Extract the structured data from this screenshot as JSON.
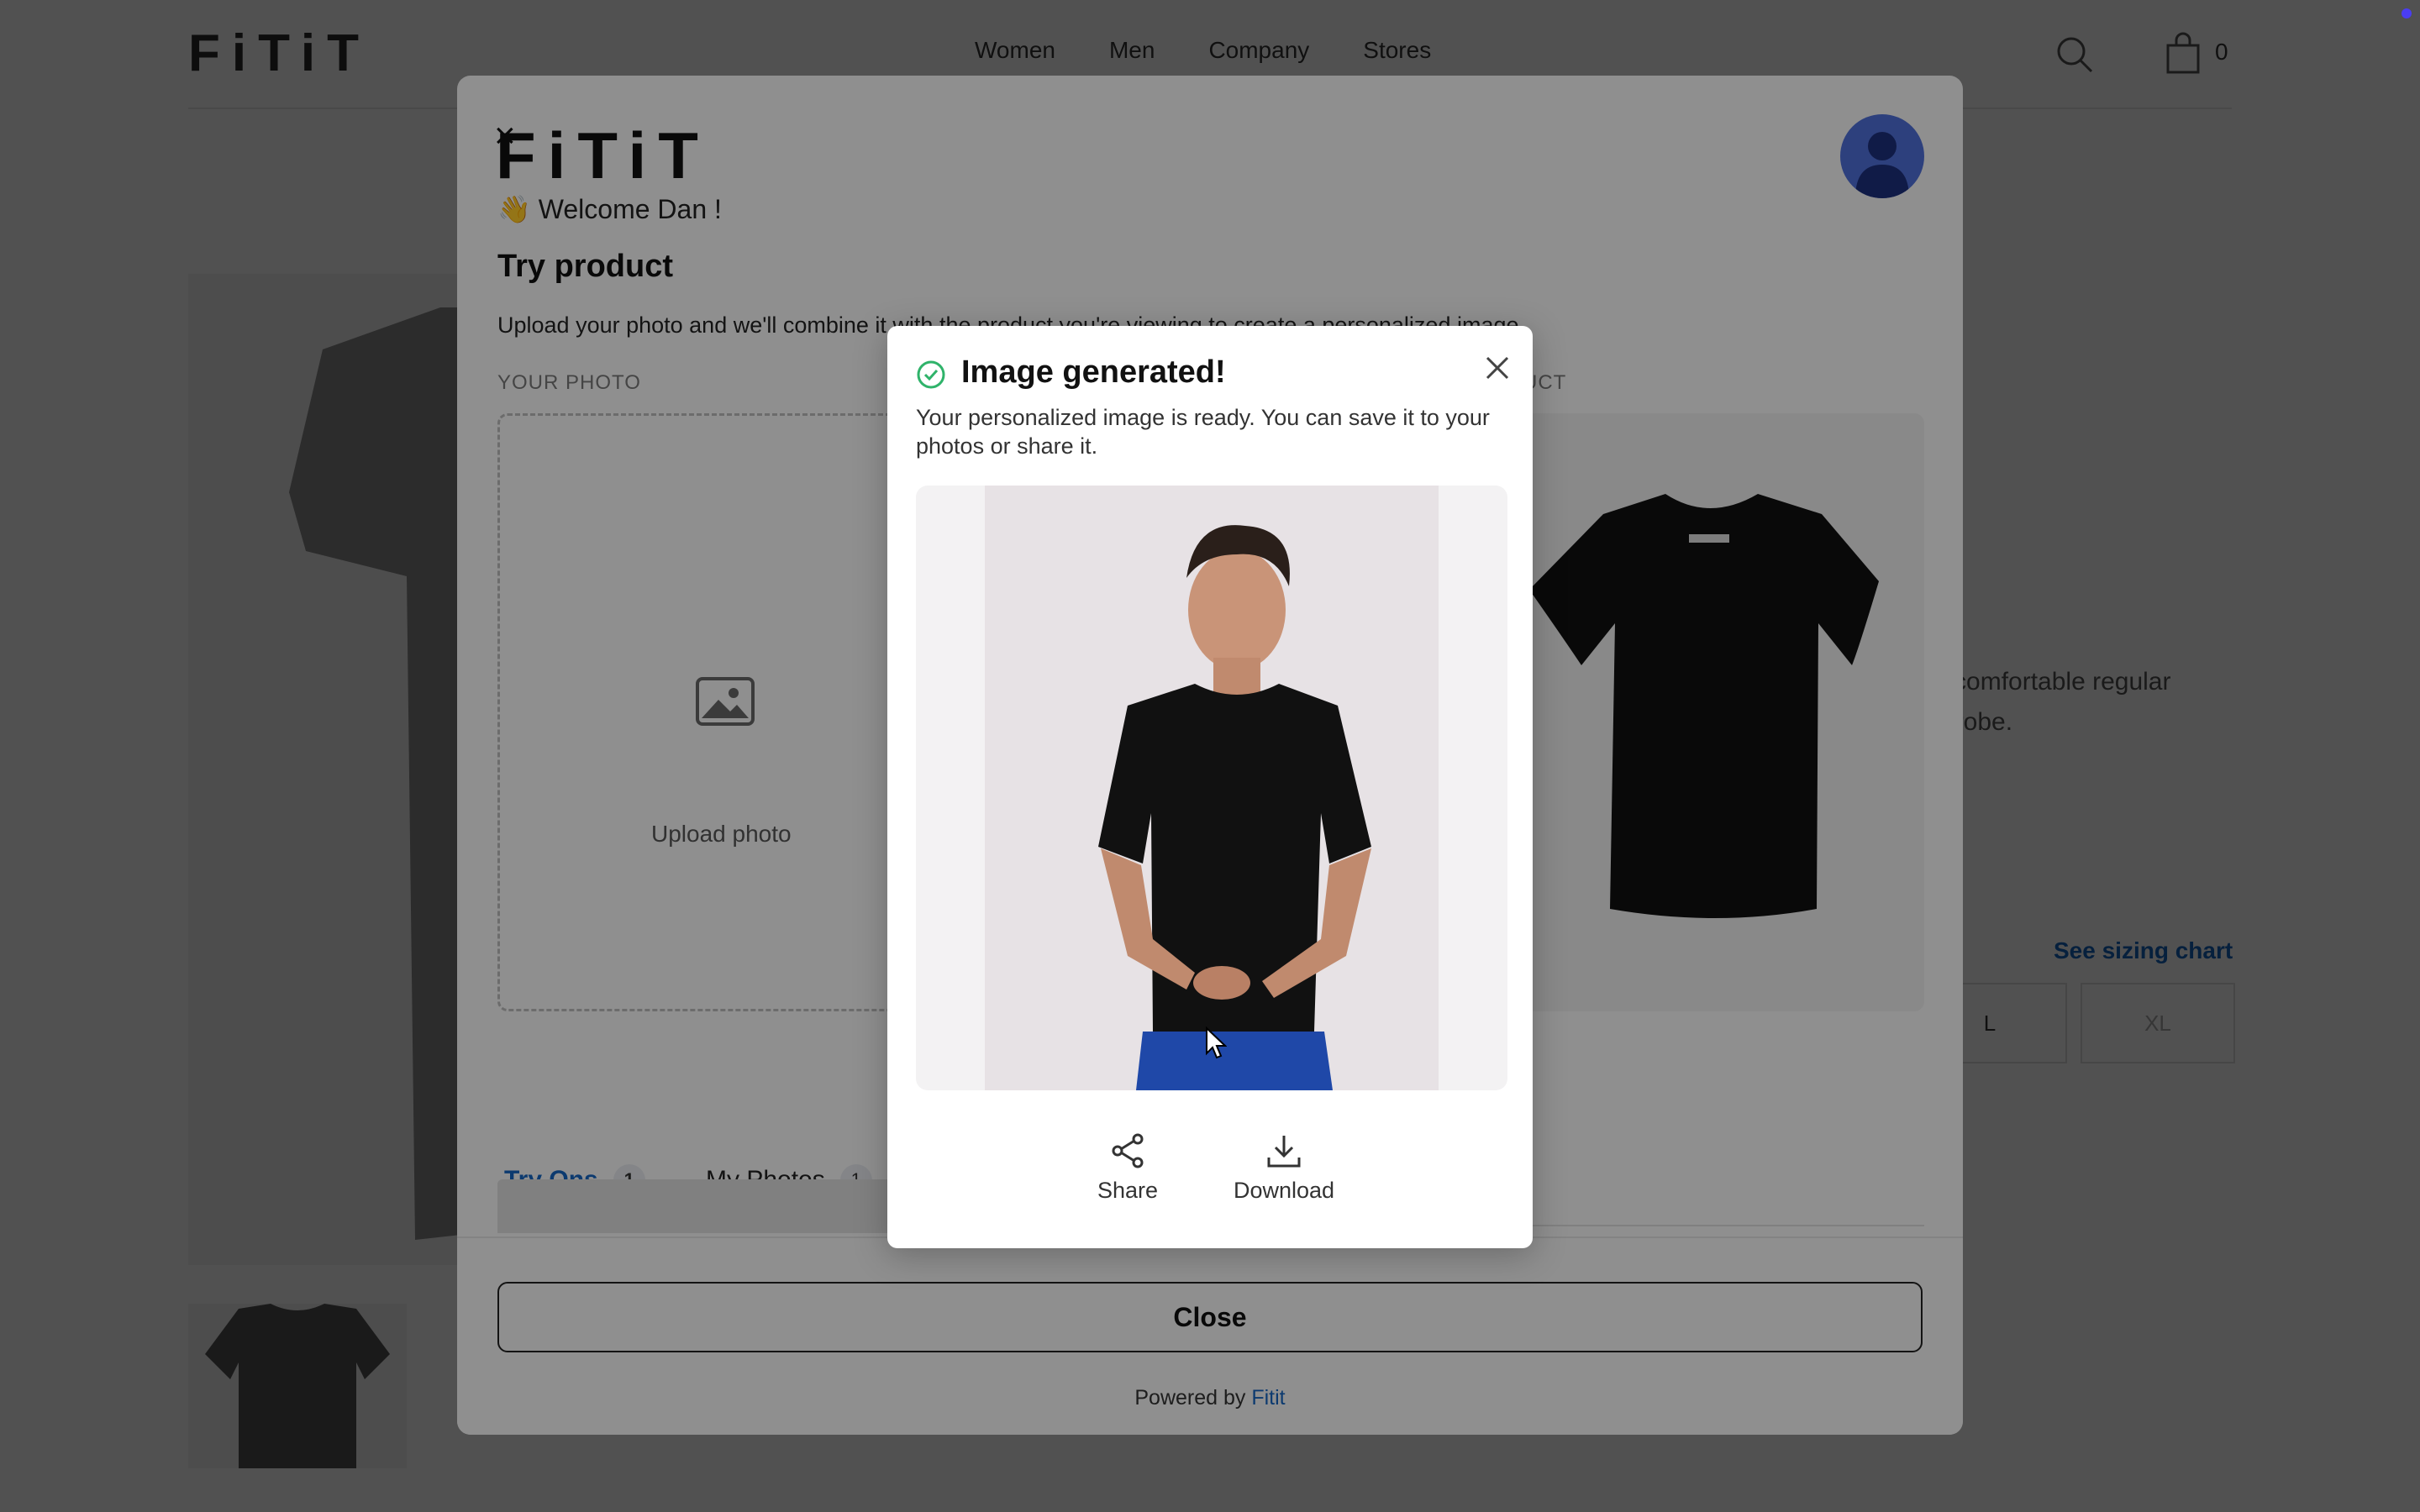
{
  "site": {
    "logo": "FiTiT",
    "nav": [
      "Women",
      "Men",
      "Company",
      "Stores"
    ],
    "cart_count": "0",
    "description_line1": "a comfortable regular",
    "description_line2": "rdrobe.",
    "sizing_link": "See sizing chart",
    "sizes": [
      "L",
      "XL"
    ]
  },
  "modal": {
    "logo": "FiTiT",
    "close_icon": "×",
    "welcome": "👋 Welcome Dan !",
    "title": "Try product",
    "subtitle": "Upload your photo and we'll combine it with the product you're viewing to create a personalized image",
    "your_photo_label": "YOUR PHOTO",
    "product_label": "UCT",
    "upload_label": "Upload photo",
    "tabs": [
      {
        "label": "Try Ons",
        "count": "1",
        "active": true
      },
      {
        "label": "My Photos",
        "count": "1",
        "active": false
      }
    ],
    "close_button": "Close",
    "powered_prefix": "Powered by",
    "powered_brand": "Fitit"
  },
  "dialog": {
    "title": "Image generated!",
    "text": "Your personalized image is ready. You can save it to your photos or share it.",
    "actions": [
      {
        "label": "Share",
        "icon": "share-icon"
      },
      {
        "label": "Download",
        "icon": "download-icon"
      }
    ]
  },
  "colors": {
    "accent": "#1565c0",
    "success": "#2fb36a",
    "avatar": "#4f6fd8",
    "shirt": "#111111",
    "shorts": "#1f48a8"
  }
}
